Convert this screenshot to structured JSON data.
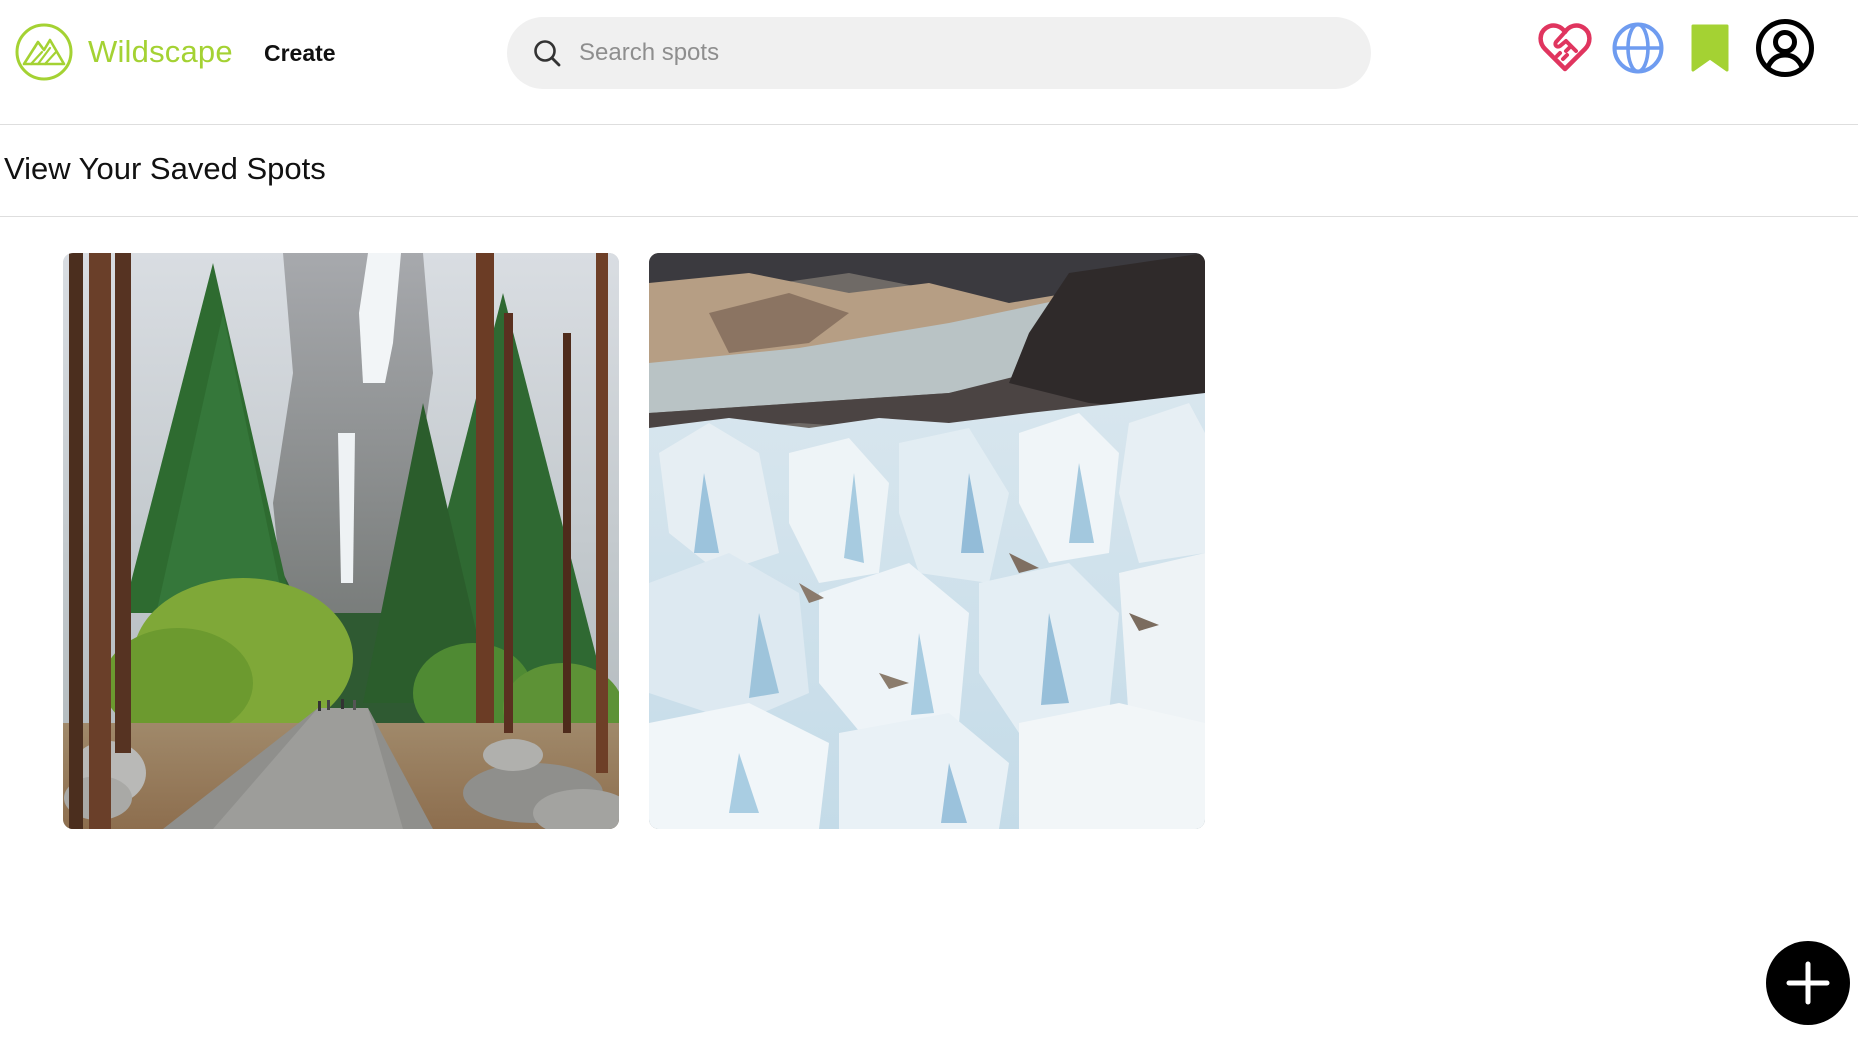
{
  "app": {
    "name": "Wildscape",
    "brand_color": "#a4d233"
  },
  "header": {
    "create_label": "Create",
    "search": {
      "placeholder": "Search spots",
      "value": ""
    },
    "nav_icons": [
      {
        "icon": "heart-handshake-icon",
        "color": "#e0355f"
      },
      {
        "icon": "globe-icon",
        "color": "#6f9cf0"
      },
      {
        "icon": "bookmark-icon",
        "color": "#a4d233"
      },
      {
        "icon": "user-circle-icon",
        "color": "#000000"
      }
    ]
  },
  "page": {
    "title": "View Your Saved Spots"
  },
  "saved_spots": [
    {
      "image": "waterfall-forest-path-photo"
    },
    {
      "image": "glacier-ice-field-photo"
    }
  ],
  "fab": {
    "icon": "plus-icon",
    "color": "#000000"
  }
}
